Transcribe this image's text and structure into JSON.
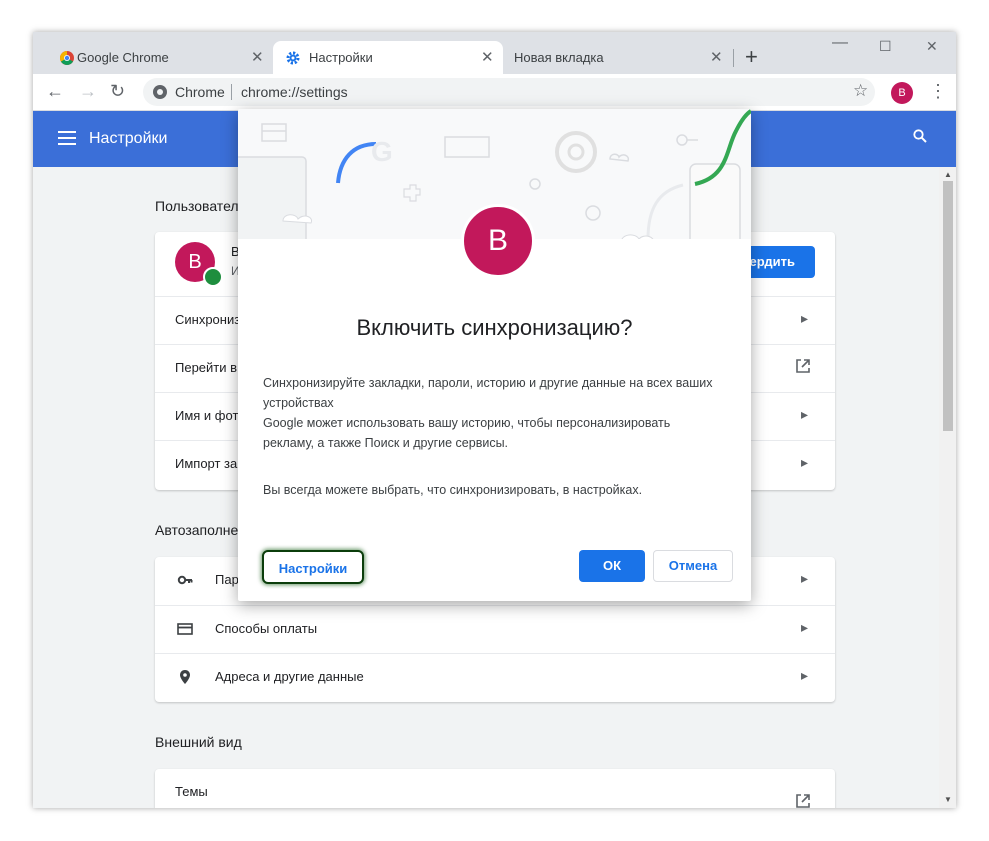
{
  "tabs": [
    {
      "label": "Google Chrome",
      "icon": "chrome-icon",
      "active": false
    },
    {
      "label": "Настройки",
      "icon": "gear-icon",
      "active": true
    },
    {
      "label": "Новая вкладка",
      "icon": "none",
      "active": false
    }
  ],
  "toolbar": {
    "site_label": "Chrome",
    "url": "chrome://settings",
    "avatar_letter": "B"
  },
  "header": {
    "title": "Настройки"
  },
  "sections": {
    "people": {
      "title": "Пользовател",
      "profile_letter": "B",
      "profile_name": "В",
      "profile_sub": "И",
      "confirm_label": "вердить",
      "rows": [
        "Синхронизі",
        "Перейти в",
        "Имя и фот",
        "Импорт за"
      ]
    },
    "autofill": {
      "title": "Автозаполне",
      "rows": [
        "Пар",
        "Способы оплаты",
        "Адреса и другие данные"
      ]
    },
    "appearance": {
      "title": "Внешний вид",
      "rows": [
        "Темы"
      ]
    }
  },
  "dialog": {
    "avatar_letter": "B",
    "title": "Включить синхронизацию?",
    "body_line1": "Синхронизируйте закладки, пароли, историю и другие данные на всех ваших устройствах",
    "body_line2": "Google может использовать вашу историю, чтобы персонализировать рекламу, а также Поиск и другие сервисы.",
    "note": "Вы всегда можете выбрать, что синхронизировать, в настройках.",
    "settings_button": "Настройки",
    "ok_button": "ОК",
    "cancel_button": "Отмена"
  },
  "colors": {
    "accent": "#1a73e8",
    "header_bg": "#3b6fd8",
    "avatar": "#c2185b",
    "sync_green": "#1e8e3e"
  }
}
